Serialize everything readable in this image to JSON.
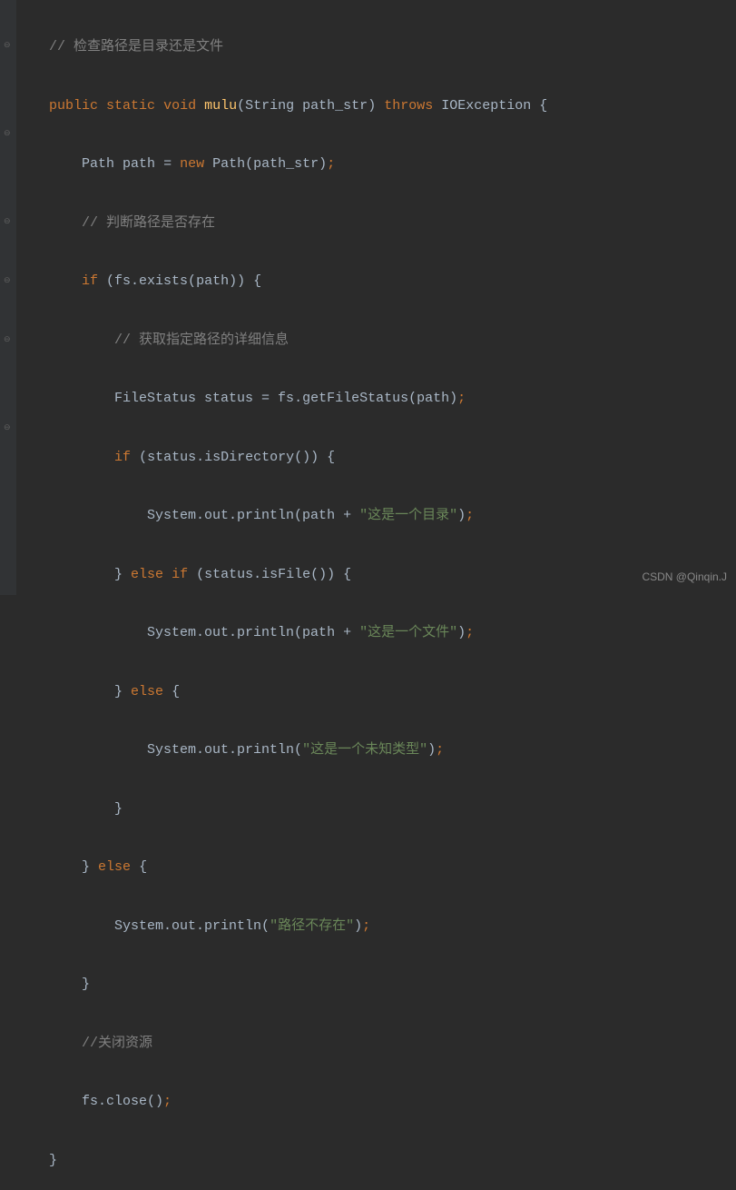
{
  "code": {
    "comment1": "// 检查路径是目录还是文件",
    "kw_public": "public",
    "kw_static": "static",
    "kw_void": "void",
    "method_name": "mulu",
    "param_type": "String",
    "param_name": "path_str",
    "kw_throws": "throws",
    "exception": "IOException",
    "type_path": "Path",
    "var_path": "path",
    "kw_new": "new",
    "comment2": "// 判断路径是否存在",
    "kw_if": "if",
    "kw_else": "else",
    "fs": "fs",
    "exists": "exists",
    "comment3": "// 获取指定路径的详细信息",
    "type_filestatus": "FileStatus",
    "var_status": "status",
    "getFileStatus": "getFileStatus",
    "isDirectory": "isDirectory",
    "isFile": "isFile",
    "system_out_println": "System.out.println",
    "str_dir": "\"这是一个目录\"",
    "str_file": "\"这是一个文件\"",
    "str_unknown": "\"这是一个未知类型\"",
    "str_notexist": "\"路径不存在\"",
    "comment4": "//关闭资源",
    "close": "close"
  },
  "watermark": "CSDN @Qinqin.J"
}
